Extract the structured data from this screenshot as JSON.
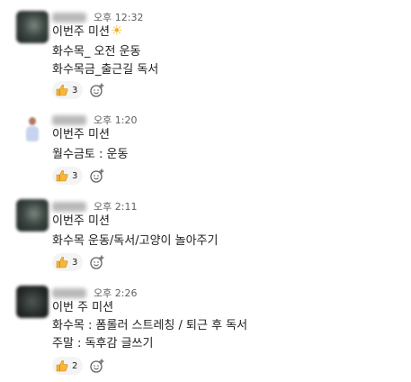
{
  "messages": [
    {
      "time": "오후 12:32",
      "lines": [
        "이번주 미션",
        "화수목_ 오전 운동",
        "화수목금_출근길 독서"
      ],
      "reaction": {
        "emoji": "thumbs-up-icon",
        "count": "3"
      }
    },
    {
      "time": "오후 1:20",
      "lines": [
        "이번주 미션",
        "월수금토 : 운동"
      ],
      "reaction": {
        "emoji": "thumbs-up-icon",
        "count": "3"
      }
    },
    {
      "time": "오후 2:11",
      "lines": [
        "이번주 미션",
        "화수목 운동/독서/고양이 놀아주기"
      ],
      "reaction": {
        "emoji": "thumbs-up-icon",
        "count": "3"
      }
    },
    {
      "time": "오후 2:26",
      "lines": [
        "이번 주 미션",
        "화수목 : 폼롤러 스트레칭 / 퇴근 후 독서",
        "주말 : 독후감 글쓰기"
      ],
      "reaction": {
        "emoji": "thumbs-up-icon",
        "count": "2"
      }
    }
  ],
  "icons": {
    "title_emoji": "sun-icon",
    "add_reaction": "add-reaction-icon"
  },
  "colors": {
    "reaction_bg": "#f4f4f4",
    "thumb": "#f6b73c",
    "timestamp": "#616061"
  }
}
